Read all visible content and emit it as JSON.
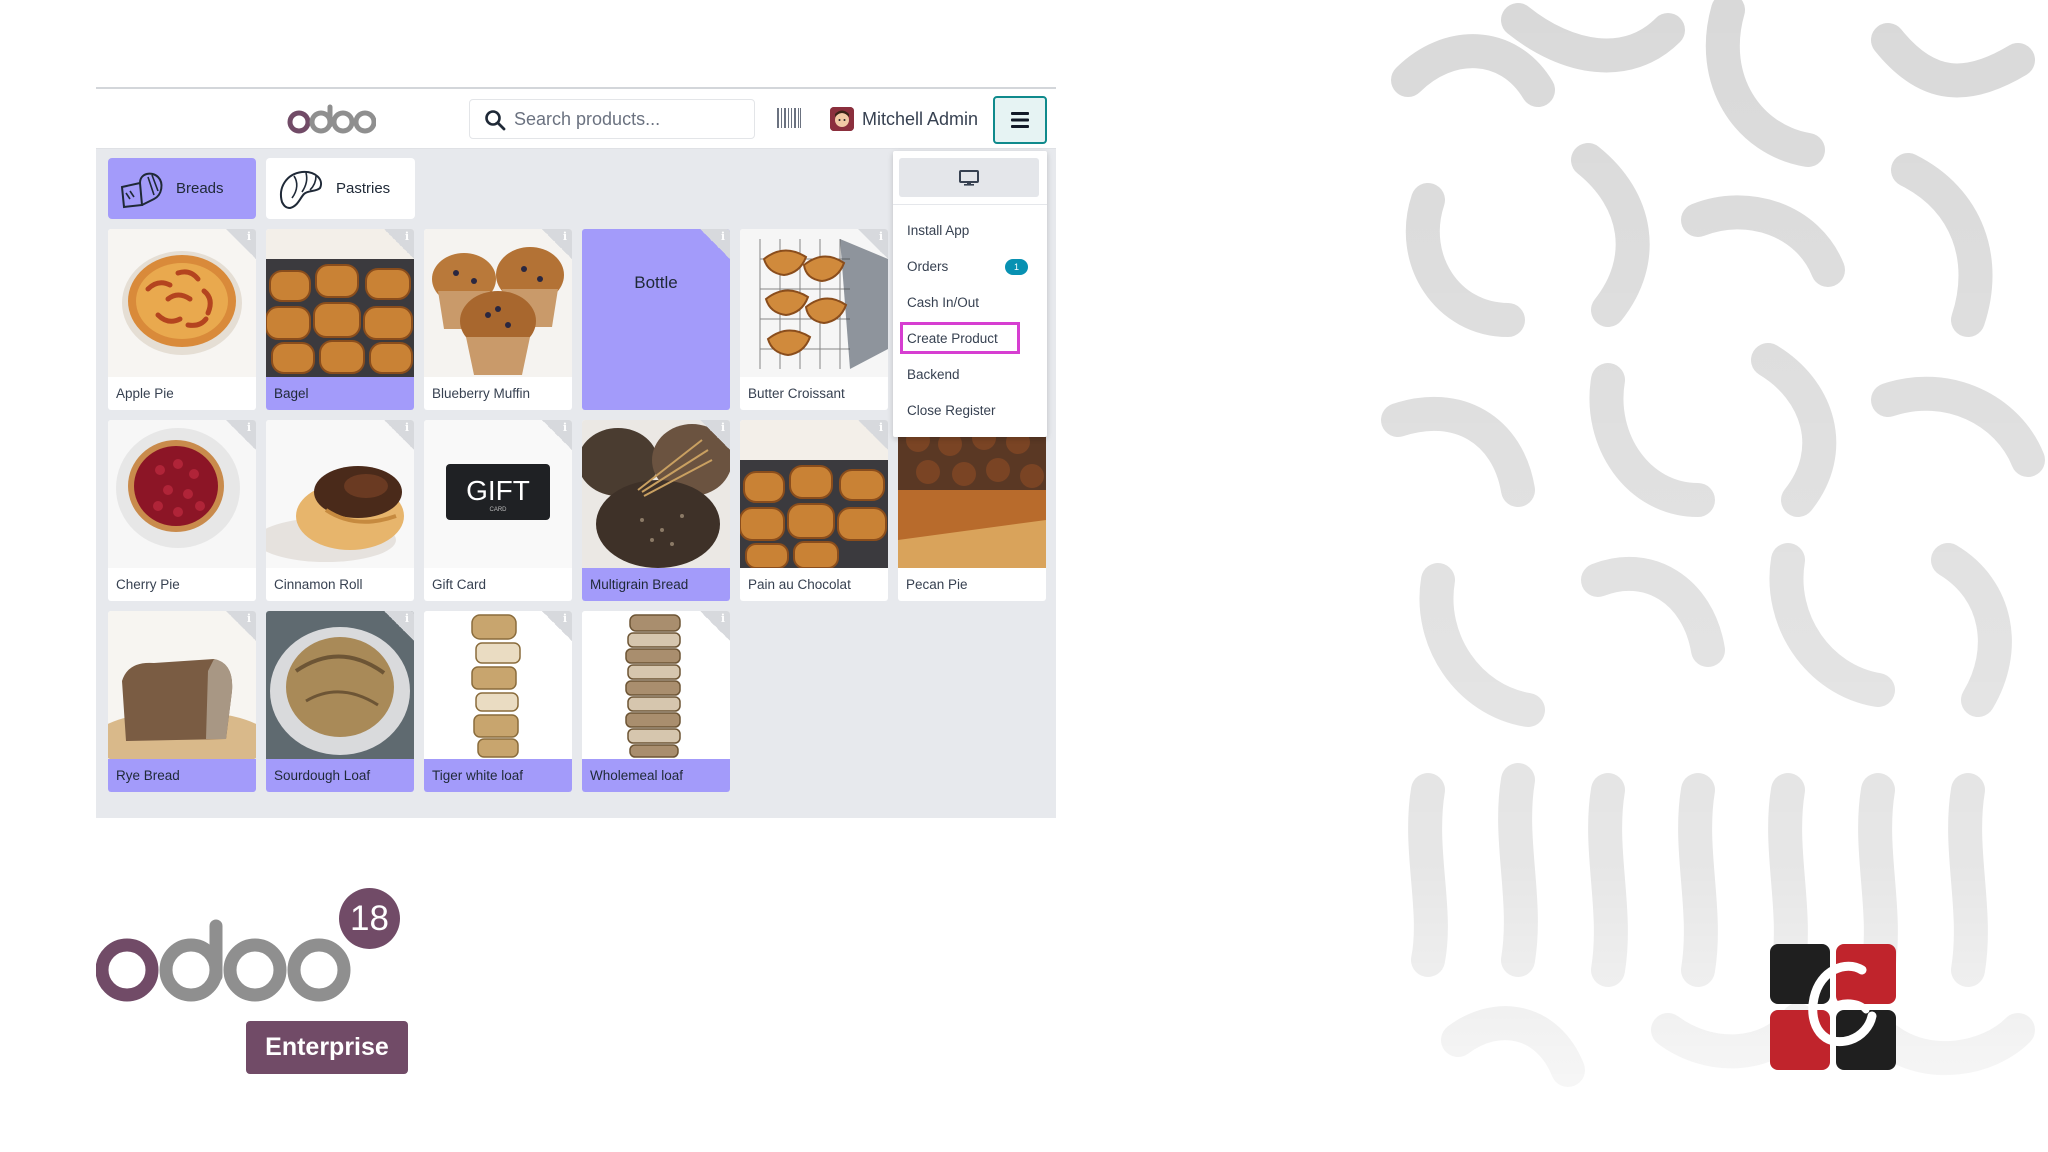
{
  "header": {
    "search_placeholder": "Search products...",
    "user_name": "Mitchell Admin"
  },
  "categories": [
    {
      "label": "Breads",
      "active": true
    },
    {
      "label": "Pastries",
      "active": false
    }
  ],
  "products": [
    {
      "name": "Apple Pie",
      "highlight": false
    },
    {
      "name": "Bagel",
      "highlight": true
    },
    {
      "name": "Blueberry Muffin",
      "highlight": false
    },
    {
      "name": "Bottle",
      "highlight": true
    },
    {
      "name": "Butter Croissant",
      "highlight": false
    },
    {
      "name": "Cherry Pie",
      "highlight": false
    },
    {
      "name": "Cinnamon Roll",
      "highlight": false
    },
    {
      "name": "Gift Card",
      "highlight": false
    },
    {
      "name": "Multigrain Bread",
      "highlight": true
    },
    {
      "name": "Pain au Chocolat",
      "highlight": false
    },
    {
      "name": "Pecan Pie",
      "highlight": false
    },
    {
      "name": "Rye Bread",
      "highlight": true
    },
    {
      "name": "Sourdough Loaf",
      "highlight": true
    },
    {
      "name": "Tiger white loaf",
      "highlight": true
    },
    {
      "name": "Wholemeal loaf",
      "highlight": true
    }
  ],
  "gift_card": {
    "title": "GIFT",
    "subtitle": "CARD"
  },
  "menu": {
    "items": [
      {
        "label": "Install App"
      },
      {
        "label": "Orders",
        "badge": "1"
      },
      {
        "label": "Cash In/Out"
      },
      {
        "label": "Create Product",
        "highlighted": true
      },
      {
        "label": "Backend"
      },
      {
        "label": "Close Register"
      }
    ]
  },
  "branding": {
    "version": "18",
    "edition": "Enterprise"
  },
  "colors": {
    "accent": "#714b67",
    "highlight_tile": "#a39bfa",
    "teal": "#0f8a8c",
    "callout": "#d63ed1"
  }
}
